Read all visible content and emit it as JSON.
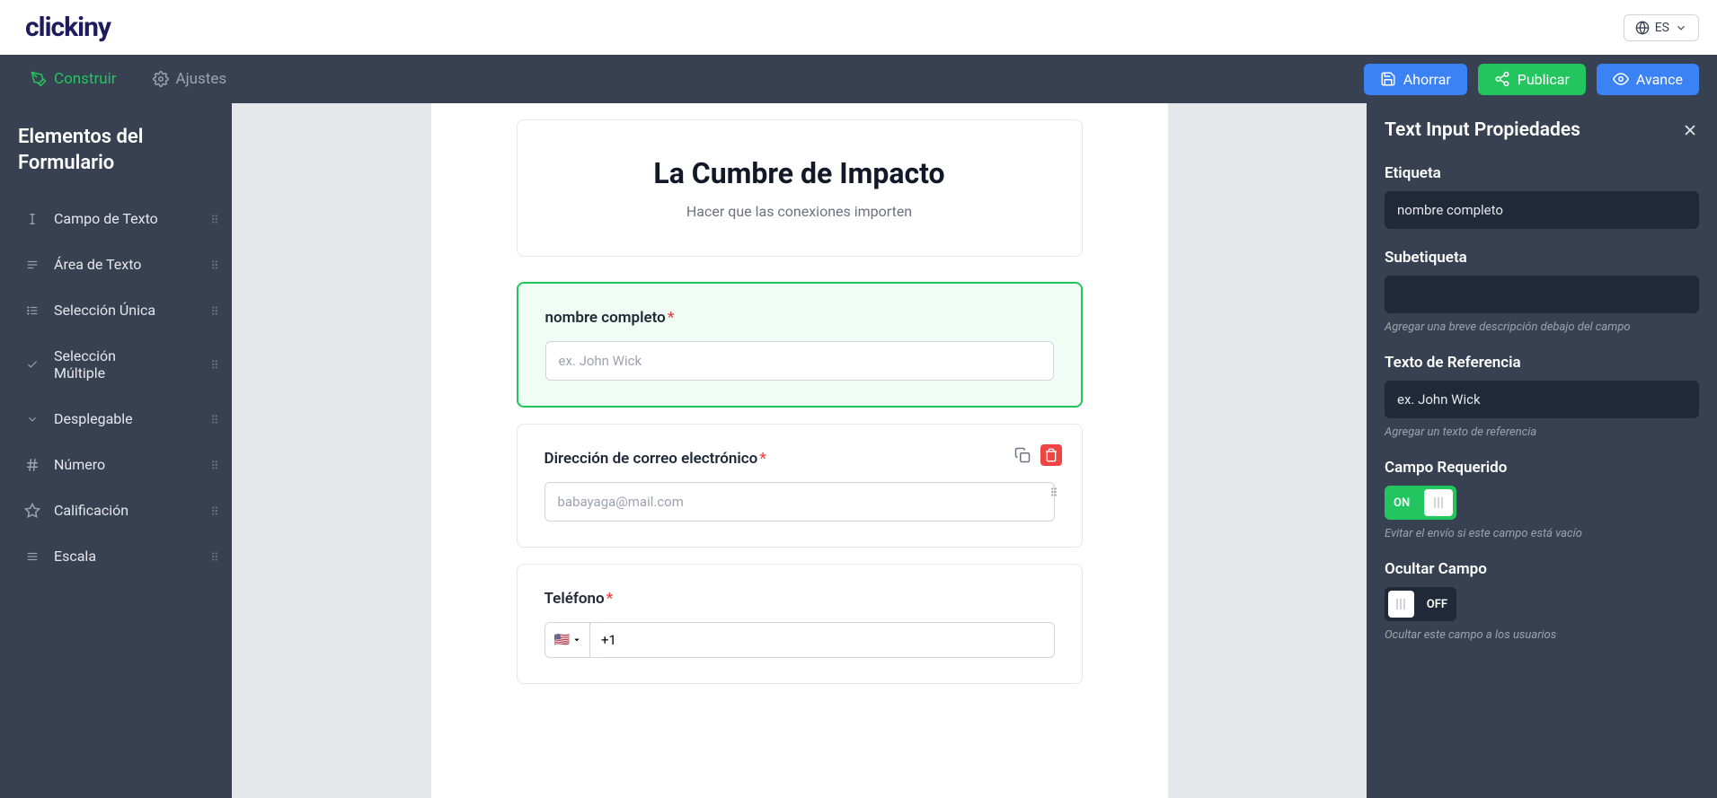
{
  "header": {
    "logo": "clickiny",
    "lang": "ES"
  },
  "navbar": {
    "tabs": {
      "build": "Construir",
      "settings": "Ajustes"
    },
    "actions": {
      "save": "Ahorrar",
      "publish": "Publicar",
      "preview": "Avance"
    }
  },
  "sidebar": {
    "title": "Elementos del Formulario",
    "elements": [
      {
        "label": "Campo de Texto"
      },
      {
        "label": "Área de Texto"
      },
      {
        "label": "Selección Única"
      },
      {
        "label": "Selección Múltiple"
      },
      {
        "label": "Desplegable"
      },
      {
        "label": "Número"
      },
      {
        "label": "Calificación"
      },
      {
        "label": "Escala"
      }
    ]
  },
  "form": {
    "title": "La Cumbre de Impacto",
    "subtitle": "Hacer que las conexiones importen",
    "fields": {
      "name": {
        "label": "nombre completo",
        "placeholder": "ex. John Wick"
      },
      "email": {
        "label": "Dirección de correo electrónico",
        "placeholder": "babayaga@mail.com"
      },
      "phone": {
        "label": "Teléfono",
        "prefix": "+1"
      }
    }
  },
  "props": {
    "title": "Text Input Propiedades",
    "groups": {
      "label": {
        "title": "Etiqueta",
        "value": "nombre completo"
      },
      "sublabel": {
        "title": "Subetiqueta",
        "value": "",
        "hint": "Agregar una breve descripción debajo del campo"
      },
      "placeholder": {
        "title": "Texto de Referencia",
        "value": "ex. John Wick",
        "hint": "Agregar un texto de referencia"
      },
      "required": {
        "title": "Campo Requerido",
        "state": "ON",
        "hint": "Evitar el envío si este campo está vacío"
      },
      "hide": {
        "title": "Ocultar Campo",
        "state": "OFF",
        "hint": "Ocultar este campo a los usuarios"
      }
    }
  }
}
